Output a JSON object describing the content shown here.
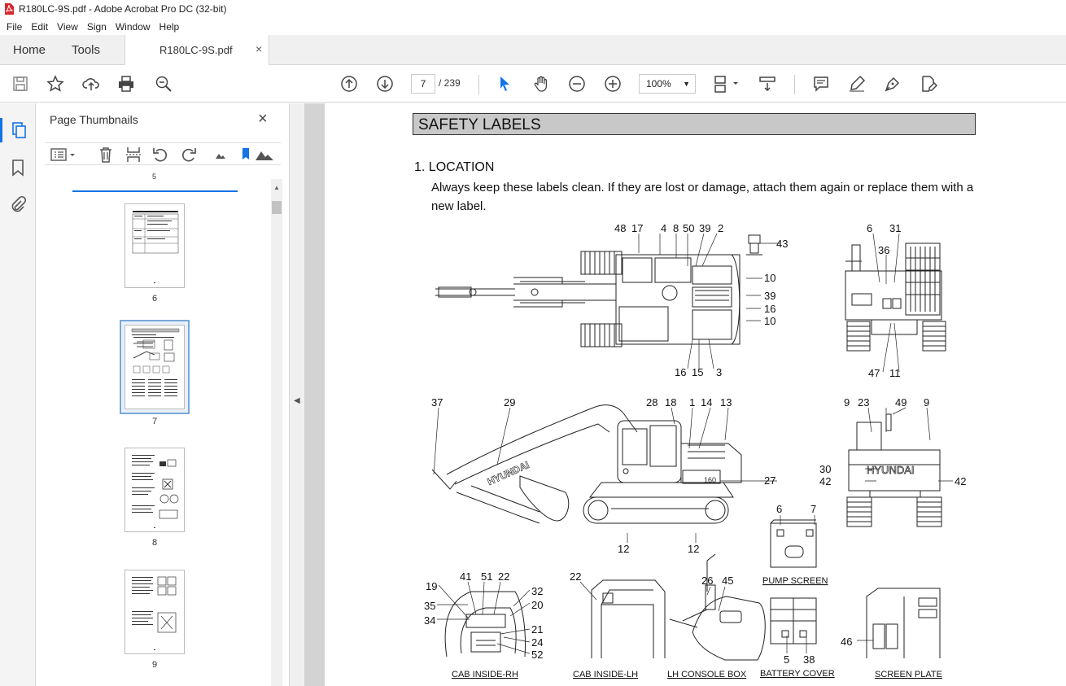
{
  "window": {
    "title": "R180LC-9S.pdf - Adobe Acrobat Pro DC (32-bit)"
  },
  "menu": [
    "File",
    "Edit",
    "View",
    "Sign",
    "Window",
    "Help"
  ],
  "tabs": {
    "home": "Home",
    "tools": "Tools",
    "document": "R180LC-9S.pdf",
    "close": "×"
  },
  "toolbar": {
    "current_page": "7",
    "page_total": "/ 239",
    "zoom": "100%"
  },
  "thumbnails": {
    "title": "Page Thumbnails",
    "close": "×",
    "top_partial": "5",
    "pages": [
      {
        "number": "6"
      },
      {
        "number": "7",
        "selected": true
      },
      {
        "number": "8"
      },
      {
        "number": "9"
      }
    ]
  },
  "document": {
    "banner": "SAFETY LABELS",
    "section": "1.  LOCATION",
    "paragraph": "Always keep these labels clean.  If they are lost or damage, attach them again or replace them with a new label.",
    "top_view_labels": [
      "48",
      "17",
      "4",
      "8",
      "50",
      "39",
      "2",
      "43",
      "10",
      "39",
      "16",
      "10",
      "16",
      "15",
      "3"
    ],
    "rear_view_labels": [
      "6",
      "31",
      "36",
      "47",
      "11"
    ],
    "side_view_labels": [
      "37",
      "29",
      "28",
      "18",
      "1",
      "14",
      "13",
      "27",
      "12",
      "12"
    ],
    "rear2_labels": [
      "9",
      "23",
      "49",
      "9",
      "30",
      "42",
      "42"
    ],
    "pump_labels": [
      "6",
      "7"
    ],
    "cab_rh_labels": [
      "19",
      "41",
      "51",
      "22",
      "32",
      "35",
      "20",
      "34",
      "21",
      "24",
      "52"
    ],
    "cab_lh_labels": [
      "22"
    ],
    "console_labels": [
      "26",
      "45"
    ],
    "battery_labels": [
      "5",
      "38"
    ],
    "screen_labels": [
      "46"
    ],
    "side_view_brand": "HYUNDAI",
    "side_view_model": "160",
    "rear2_brand": "HYUNDAI",
    "captions": {
      "pump": "PUMP SCREEN",
      "cab_rh": "CAB INSIDE-RH",
      "cab_lh": "CAB INSIDE-LH",
      "console": "LH CONSOLE BOX",
      "battery": "BATTERY COVER",
      "screen": "SCREEN PLATE"
    }
  }
}
